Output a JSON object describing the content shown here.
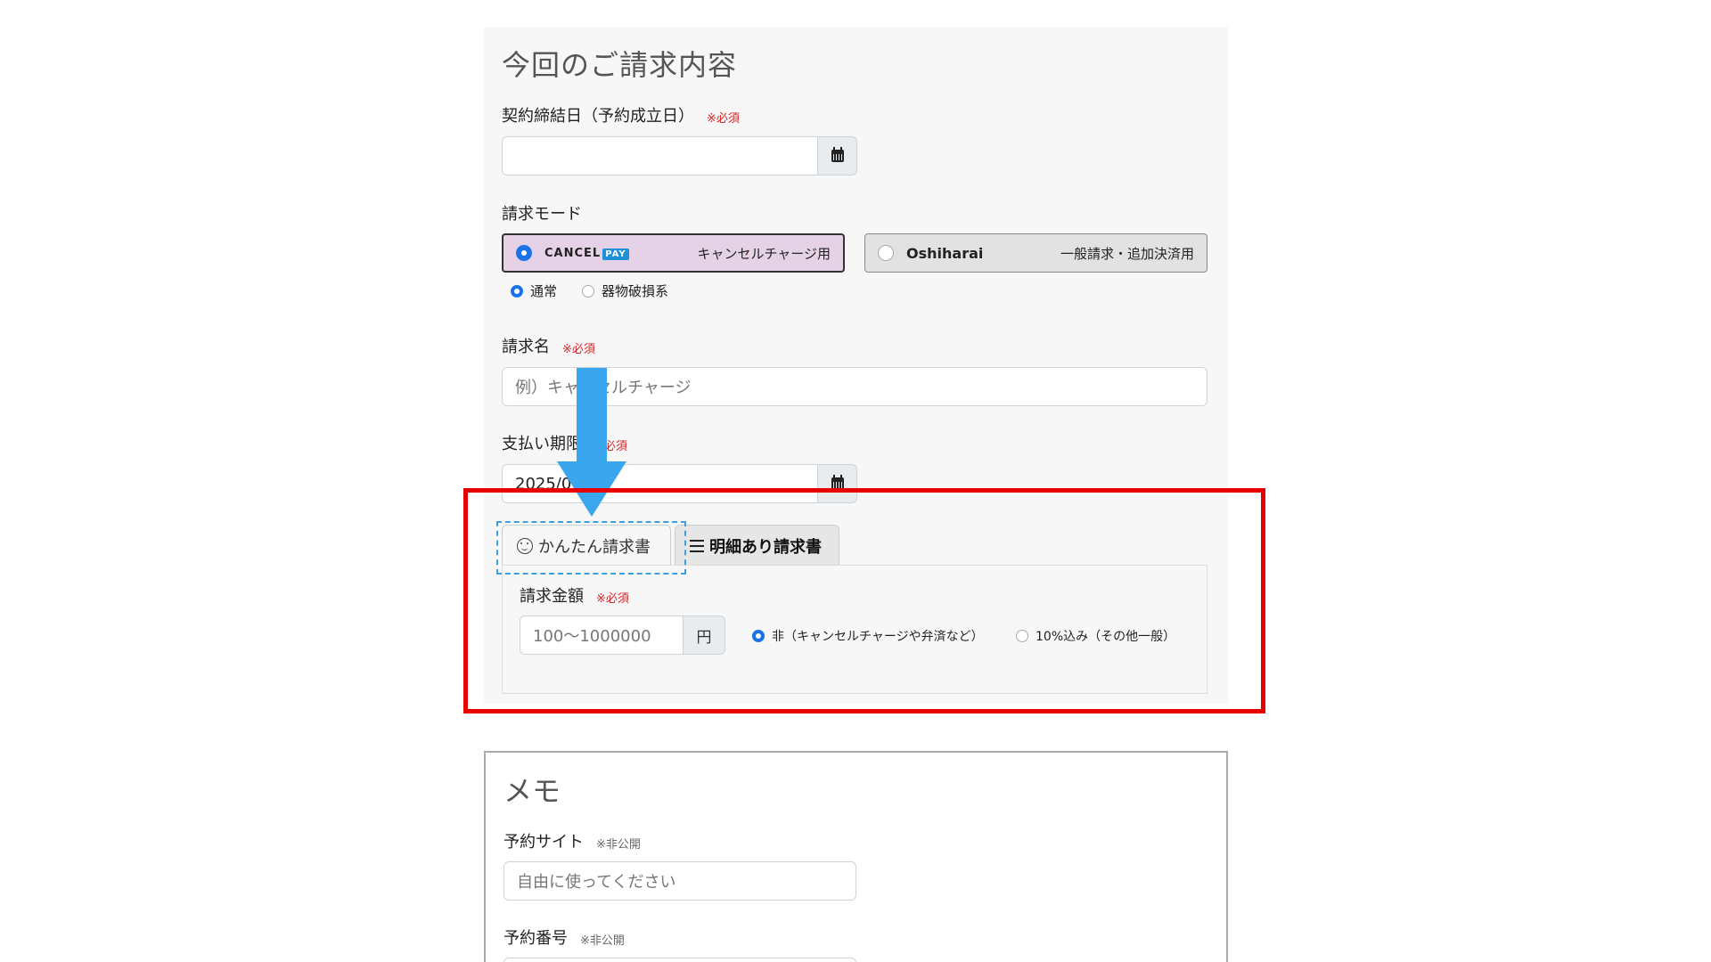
{
  "billing": {
    "title": "今回のご請求内容",
    "contract_date_label": "契約締結日（予約成立日）",
    "required": "※必須",
    "contract_date_value": "",
    "mode_label": "請求モード",
    "mode_cancel": {
      "brand": "CANCEL",
      "brand_badge": "PAY",
      "desc": "キャンセルチャージ用"
    },
    "mode_oshi": {
      "brand": "Oshiharai",
      "desc": "一般請求・追加決済用"
    },
    "sub_options": [
      "通常",
      "器物破損系"
    ],
    "name_label": "請求名",
    "name_placeholder": "例）キャンセルチャージ",
    "due_label": "支払い期限",
    "due_value": "2025/0",
    "tab_simple": "かんたん請求書",
    "tab_detail": "明細あり請求書",
    "amount_label": "請求金額",
    "amount_placeholder": "100〜1000000",
    "amount_unit": "円",
    "tax_options": [
      "非（キャンセルチャージや弁済など）",
      "10%込み（その他一般）"
    ]
  },
  "memo": {
    "title": "メモ",
    "private": "※非公開",
    "site_label": "予約サイト",
    "site_placeholder": "自由に使ってください",
    "number_label": "予約番号"
  },
  "colors": {
    "accent_blue": "#1a73e8",
    "highlight_red": "#e60000",
    "arrow_blue": "#3aa6ee",
    "required_red": "#d62020"
  }
}
